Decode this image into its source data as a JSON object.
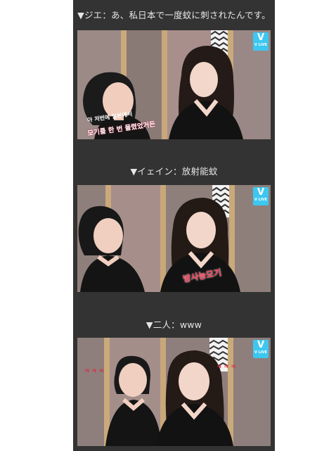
{
  "captions": {
    "first": "▼ジエ：あ、私日本で一度蚊に刺されたんです。",
    "second": "▼イェイン：放射能蚊",
    "third": "▼二人：www"
  },
  "badge": {
    "v": "V",
    "text": "V LIVE",
    "color": "#3cc7f0"
  },
  "frames": {
    "first_subtitle_top": "아 저번에 일본에서",
    "first_subtitle_bottom": "모기를 한 번 물렸었거든",
    "second_subtitle": "방사능모기",
    "third_laugh_left": "ㅋ ㅋ ㅋ",
    "third_laugh_right": "ㅋ ㅋ ㅋ"
  }
}
